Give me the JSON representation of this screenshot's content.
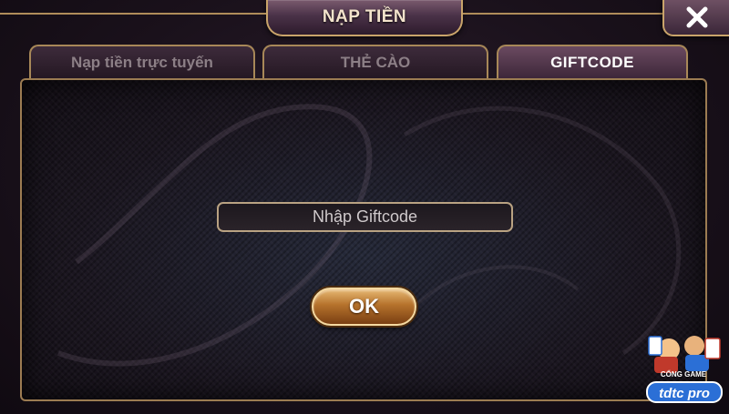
{
  "header": {
    "title": "NẠP TIỀN",
    "close_icon": "close-icon"
  },
  "tabs": [
    {
      "label": "Nạp tiền trực tuyến",
      "active": false
    },
    {
      "label": "THẺ CÀO",
      "active": false
    },
    {
      "label": "GIFTCODE",
      "active": true
    }
  ],
  "giftcode": {
    "placeholder": "Nhập Giftcode",
    "value": "",
    "ok_label": "OK"
  },
  "logo": {
    "top_text": "CỔNG GAME",
    "brand_text": "tdtc pro"
  },
  "colors": {
    "gold_border": "#c9a46a",
    "ok_button": "#b5722c",
    "active_tab": "#6a4a60",
    "logo_blue": "#2b6fd6"
  }
}
